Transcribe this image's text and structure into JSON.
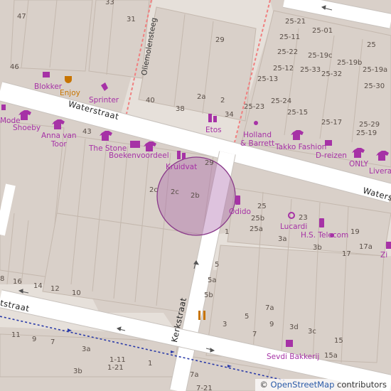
{
  "map": {
    "streets": {
      "waterstraat": "Waterstraat",
      "waterstraat_right": "Waters",
      "kerkstraat": "Kerkstraat",
      "oliemolensteeg": "Oliemolensteeg",
      "bottom_street": "tstraat"
    },
    "house_numbers": {
      "n47": "47",
      "n33": "33",
      "n31": "31",
      "n46": "46",
      "n29top": "29",
      "n40": "40",
      "n38": "38",
      "n2a": "2a",
      "n2": "2",
      "n34": "34",
      "n43": "43",
      "n29": "29",
      "n2c": "2c",
      "n2cc": "2c",
      "n2b": "2b",
      "n1": "1",
      "n25_21": "25-21",
      "n25_01": "25-01",
      "n25": "25",
      "n25_11": "25-11",
      "n25_22": "25-22",
      "n25_19c": "25-19c",
      "n25_19b": "25-19b",
      "n25_12": "25-12",
      "n25_33": "25-33",
      "n25_19a": "25-19a",
      "n25_32": "25-32",
      "n25_13": "25-13",
      "n25_30": "25-30",
      "n25_24": "25-24",
      "n25_23": "25-23",
      "n25_15": "25-15",
      "n25_17": "25-17",
      "n25_29": "25-29",
      "n25_19": "25-19",
      "n25b": "25",
      "n25b2": "25b",
      "n25a": "25a",
      "n23": "23",
      "n3a": "3a",
      "n3b": "3b",
      "n19": "19",
      "n17a": "17a",
      "n17": "17",
      "n5": "5",
      "n5a": "5a",
      "n5b": "5b",
      "n3": "3",
      "n5c": "5",
      "n7": "7",
      "n7a": "7a",
      "n9": "9",
      "n3d": "3d",
      "n3c": "3c",
      "n15": "15",
      "n15a": "15a",
      "n8": "8",
      "n16": "16",
      "n14": "14",
      "n12": "12",
      "n10": "10",
      "n11": "11",
      "n9l": "9",
      "n7l": "7",
      "n3al": "3a",
      "n3bl": "3b",
      "n1_11": "1-11",
      "n1_21": "1-21",
      "n1l": "1",
      "n7a2": "7a",
      "n7_21": "7-21"
    },
    "pois": {
      "blokker": "Blokker",
      "enjoy": "Enjoy",
      "sprinter": "Sprinter",
      "mode": "Mode",
      "shoeby": "Shoeby",
      "anna": "Anna van\nToor",
      "the_stone": "The Stone",
      "boekenvoordeel": "Boekenvoordeel",
      "kruidvat": "Kruidvat",
      "etos": "Etos",
      "holland": "Holland\n& Barrett",
      "takko": "Takko Fashion",
      "dreizen": "D-reizen",
      "only": "ONLY",
      "livera": "Livera",
      "odido": "Odido",
      "lucardi": "Lucardi",
      "hs_telecom": "H.S. Telecom",
      "zi": "Zi",
      "sevdi": "Sevdi Bakkerij"
    },
    "attribution": {
      "prefix": "© ",
      "link": "OpenStreetMap",
      "suffix": " contributors"
    },
    "colors": {
      "building": "#d9d0c9",
      "road": "#ffffff",
      "road_edge": "#c8c2bd",
      "poi": "#a632a6",
      "food": "#c77400",
      "circle": "rgba(160,80,160,0.35)"
    }
  }
}
